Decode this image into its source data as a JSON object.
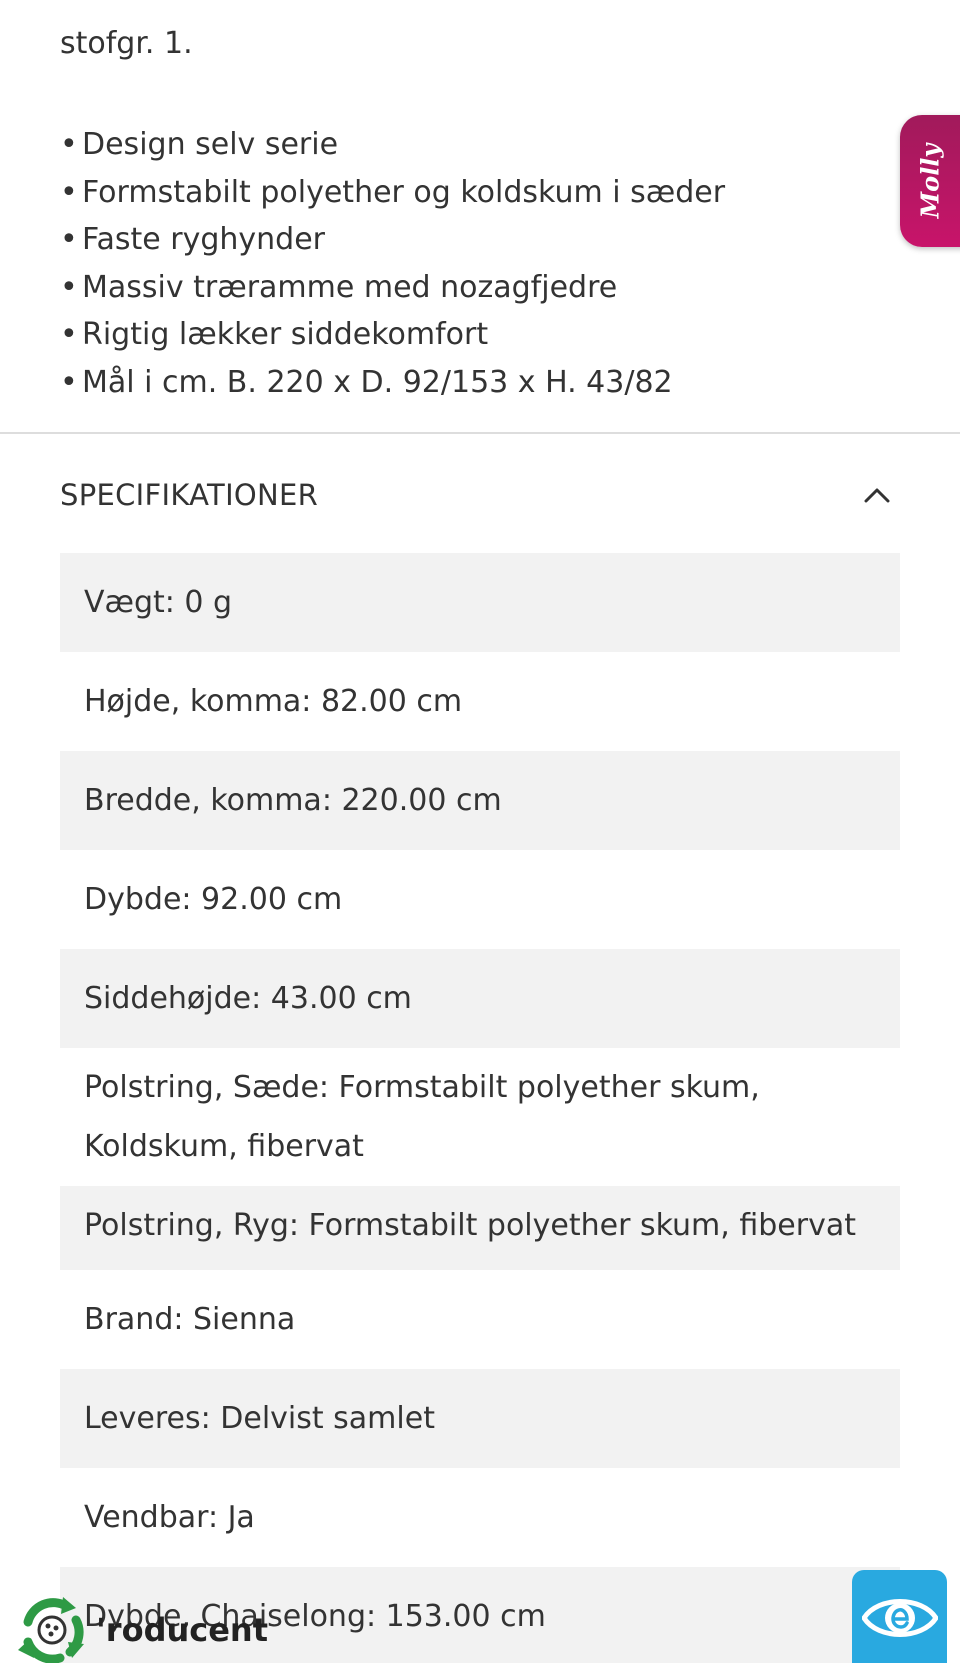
{
  "intro": {
    "text": "stofgr. 1."
  },
  "features": [
    "Design selv serie",
    "Formstabilt polyether og koldskum i sæder",
    "Faste ryghynder",
    "Massiv træramme med nozagfjedre",
    "Rigtig lækker siddekomfort",
    "Mål i cm. B. 220 x D. 92/153 x H. 43/82"
  ],
  "specifications": {
    "title": "SPECIFIKATIONER",
    "rows": [
      "Vægt: 0 g",
      "Højde, komma: 82.00 cm",
      "Bredde, komma: 220.00 cm",
      "Dybde: 92.00 cm",
      "Siddehøjde: 43.00 cm",
      "Polstring, Sæde: Formstabilt polyether skum, Koldskum, fibervat",
      "Polstring, Ryg: Formstabilt polyether skum, fibervat",
      "Brand: Sienna",
      "Leveres: Delvist samlet",
      "Vendbar: Ja",
      "Dybde, Chaiselong: 153.00 cm"
    ]
  },
  "next_section": {
    "label": "'roducent"
  },
  "molly_tab": {
    "label": "Molly",
    "color": "#b0165f"
  },
  "widgets": {
    "recycle_icon": "recycle-icon",
    "eye_icon": "eye-icon",
    "eye_color": "#29a9e0"
  }
}
